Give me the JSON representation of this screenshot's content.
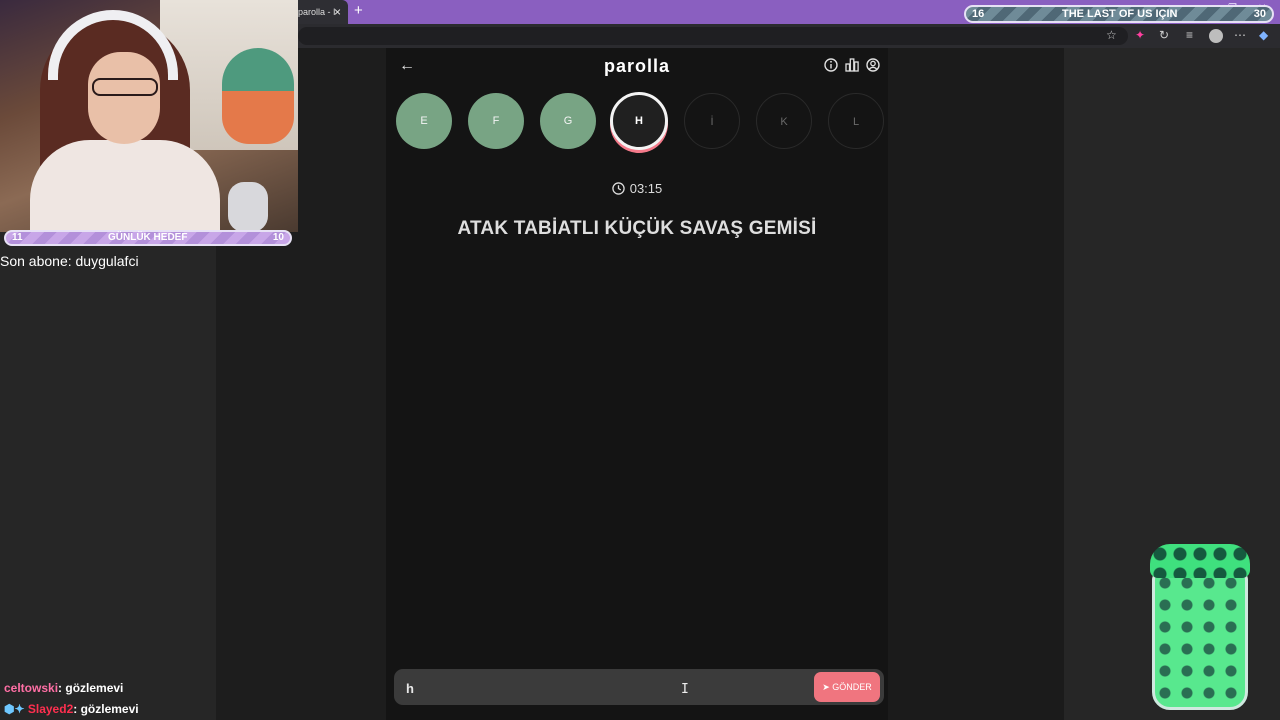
{
  "browser": {
    "tab_title": "parolla - I",
    "new_tab": "+",
    "tab_close": "×"
  },
  "stream_goal_top": {
    "left_value": "16",
    "title": "THE LAST OF US IÇIN",
    "right_value": "30"
  },
  "stream_goal_left": {
    "left_value": "11",
    "title": "GÜNLÜK HEDEF",
    "right_value": "10"
  },
  "last_subscriber": "Son abone: duygulafci",
  "chat": [
    {
      "user": "celtowski",
      "message": ": gözlemevi"
    },
    {
      "user": "Slayed2",
      "message": ": gözlemevi"
    }
  ],
  "game": {
    "logo": "parolla",
    "letters": [
      {
        "letter": "E",
        "state": "done"
      },
      {
        "letter": "F",
        "state": "done"
      },
      {
        "letter": "G",
        "state": "done"
      },
      {
        "letter": "H",
        "state": "current"
      },
      {
        "letter": "İ",
        "state": "future"
      },
      {
        "letter": "K",
        "state": "future"
      },
      {
        "letter": "L",
        "state": "future"
      }
    ],
    "timer": "03:15",
    "question": "ATAK TABİATLI KÜÇÜK SAVAŞ GEMİSİ",
    "answer_value": "h",
    "send_label": "GÖNDER"
  },
  "colors": {
    "done_circle": "#78a484",
    "send_button": "#f0757f",
    "tabstrip": "#8a5fc0"
  }
}
